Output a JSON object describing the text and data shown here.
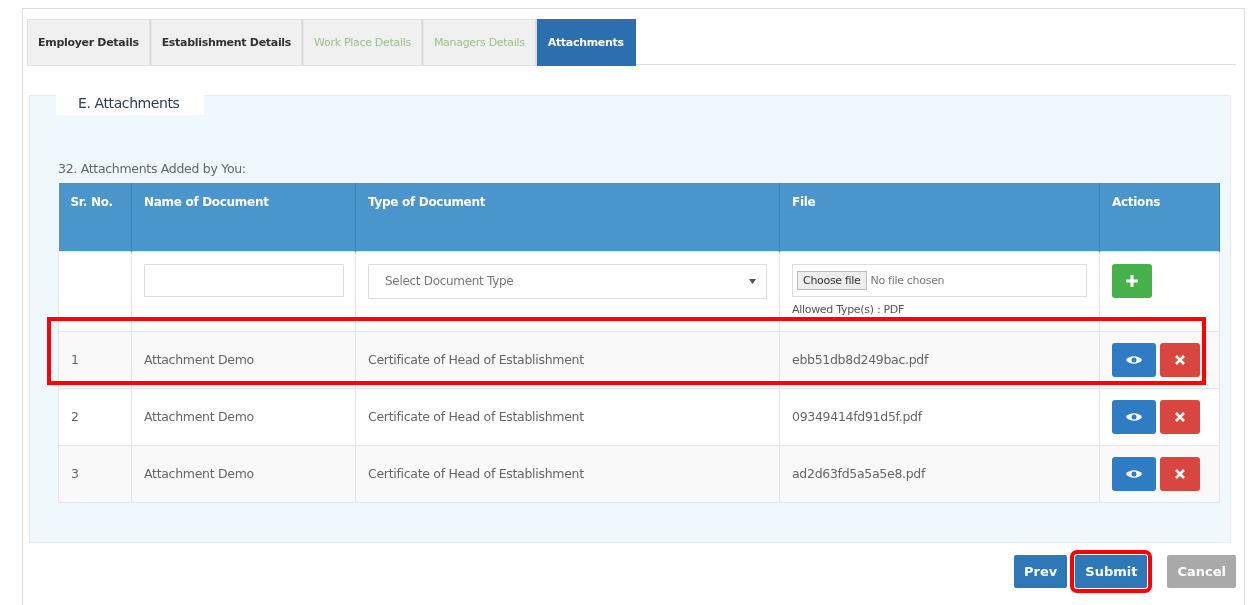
{
  "tabs": [
    {
      "label": "Employer Details",
      "selected": false,
      "disabled": false
    },
    {
      "label": "Establishment Details",
      "selected": false,
      "disabled": false
    },
    {
      "label": "Work Place Details",
      "selected": false,
      "disabled": true
    },
    {
      "label": "Managers Details",
      "selected": false,
      "disabled": true
    },
    {
      "label": "Attachments",
      "selected": true,
      "disabled": false
    }
  ],
  "section": {
    "legend": "E. Attachments",
    "caption": "32. Attachments Added by You:"
  },
  "table": {
    "columns": [
      "Sr. No.",
      "Name of Document",
      "Type of Document",
      "File",
      "Actions"
    ],
    "new_row": {
      "type_select": "Select Document Type",
      "file_button": "Choose file",
      "file_status": "No file chosen",
      "hint": "Allowed Type(s) : PDF"
    },
    "rows": [
      {
        "sr": "1",
        "name": "Attachment Demo",
        "type": "Certificate of Head of Establishment",
        "file": "ebb51db8d249bac.pdf",
        "highlighted": true
      },
      {
        "sr": "2",
        "name": "Attachment Demo",
        "type": "Certificate of Head of Establishment",
        "file": "09349414fd91d5f.pdf",
        "highlighted": false
      },
      {
        "sr": "3",
        "name": "Attachment Demo",
        "type": "Certificate of Head of Establishment",
        "file": "ad2d63fd5a5a5e8.pdf",
        "highlighted": false
      }
    ]
  },
  "buttons": [
    {
      "label": "Prev",
      "kind": "primary",
      "highlighted": false
    },
    {
      "label": "Submit",
      "kind": "primary",
      "highlighted": true
    },
    {
      "label": "Cancel",
      "kind": "secondary",
      "highlighted": false
    }
  ]
}
